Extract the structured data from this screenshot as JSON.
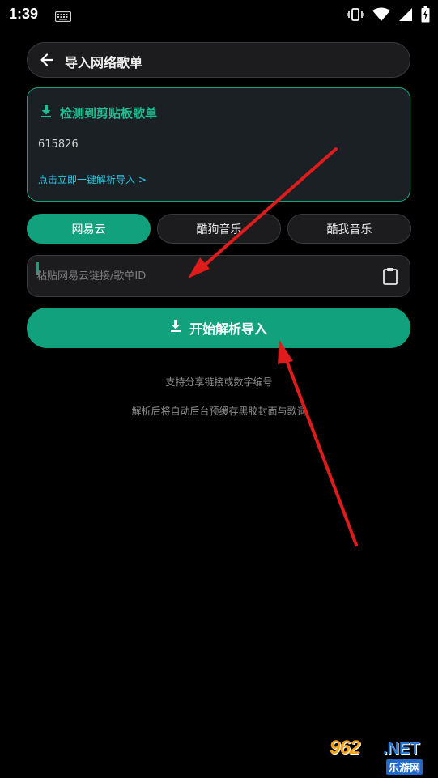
{
  "status_bar": {
    "time": "1:39",
    "icons": [
      "keyboard-icon",
      "vibrate-icon",
      "wifi-icon",
      "signal-icon",
      "battery-charging-icon"
    ]
  },
  "header": {
    "back_icon": "arrow-left-icon",
    "title": "导入网络歌单"
  },
  "clipboard_card": {
    "icon": "download-icon",
    "title": "检测到剪贴板歌单",
    "value": "615826",
    "action_link": "点击立即一键解析导入 >",
    "accent_color": "#1fbd92"
  },
  "platform_tabs": [
    {
      "label": "网易云",
      "active": true
    },
    {
      "label": "酷狗音乐",
      "active": false
    },
    {
      "label": "酷我音乐",
      "active": false
    }
  ],
  "link_input": {
    "value": "",
    "placeholder": "粘贴网易云链接/歌单ID",
    "paste_icon": "clipboard-icon"
  },
  "start_button": {
    "icon": "download-icon",
    "label": "开始解析导入",
    "color": "#12a17d"
  },
  "hints": {
    "line1": "支持分享链接或数字编号",
    "line2": "解析后将自动后台预缓存黑胶封面与歌词"
  },
  "watermark": {
    "brand_number": "962",
    "brand_suffix": ".NET",
    "brand_sub": "乐游网"
  },
  "annotation": {
    "arrow_color": "#e01b1b"
  }
}
